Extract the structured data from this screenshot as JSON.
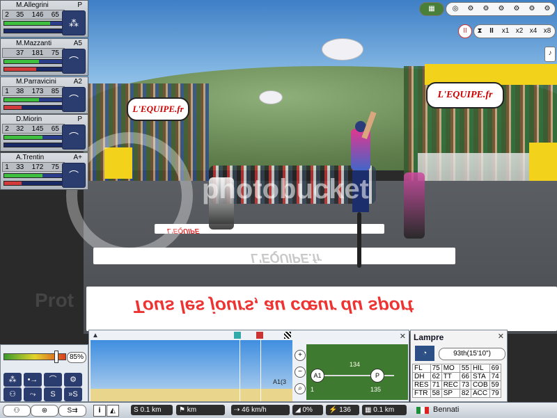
{
  "riders": [
    {
      "pos": "2",
      "name": "M.Allegrini",
      "role": "P",
      "stats": [
        "35",
        "146",
        "65"
      ],
      "bar1_fill": 0.78,
      "bar2_fill": 0.0
    },
    {
      "pos": "",
      "name": "M.Mazzanti",
      "role": "A5",
      "stats": [
        "37",
        "181",
        "75"
      ],
      "bar1_fill": 0.6,
      "bar2_fill": 0.55
    },
    {
      "pos": "1",
      "name": "M.Parravicini",
      "role": "A2",
      "stats": [
        "38",
        "173",
        "85"
      ],
      "bar1_fill": 0.6,
      "bar2_fill": 0.3
    },
    {
      "pos": "2",
      "name": "D.Miorin",
      "role": "P",
      "stats": [
        "32",
        "145",
        "65"
      ],
      "bar1_fill": 0.65,
      "bar2_fill": 0.0
    },
    {
      "pos": "1",
      "name": "A.Trentin",
      "role": "A+",
      "stats": [
        "33",
        "172",
        "75"
      ],
      "bar1_fill": 0.65,
      "bar2_fill": 0.3
    }
  ],
  "scene": {
    "banner_left": "L'EQUIPE.fr",
    "banner_right": "L'EQUIPE.fr",
    "road_text_1": "L'EQUIPE",
    "road_text_2": "L'EQUIPE.fr",
    "road_text_3": "Tous les jours, au cœur du sport",
    "watermark_1": "photobucket",
    "watermark_2": "Prot"
  },
  "speed_controls": {
    "pause": "II",
    "x1": "x1",
    "x2": "x2",
    "x4": "x4",
    "x8": "x8"
  },
  "energy": {
    "percent": "85%",
    "fill": 0.85
  },
  "profile": {
    "label_a1": "A1",
    "label_p": "P",
    "marker_a1": "A1",
    "marker_start": "1",
    "marker_end": "135",
    "marker_mid": "134",
    "sub_label": "A1(3"
  },
  "team": {
    "name": "Lampre",
    "result": "93th(15'10\")",
    "stats": [
      [
        [
          "FL",
          "75"
        ],
        [
          "MO",
          "55"
        ],
        [
          "HIL",
          "69"
        ]
      ],
      [
        [
          "DH",
          "62"
        ],
        [
          "TT",
          "66"
        ],
        [
          "STA",
          "74"
        ]
      ],
      [
        [
          "RES",
          "71"
        ],
        [
          "REC",
          "73"
        ],
        [
          "COB",
          "59"
        ]
      ],
      [
        [
          "FTR",
          "58"
        ],
        [
          "SP",
          "82"
        ],
        [
          "ACC",
          "79"
        ]
      ]
    ]
  },
  "statusbar": {
    "dist1": "0.1 km",
    "dist2": "km",
    "speed": "46 km/h",
    "slope": "0%",
    "power": "136",
    "remaining": "0.1 km",
    "rider_name": "Bennati"
  },
  "colors": {
    "bar_green": "#3fbf3f",
    "bar_red": "#d23b3b",
    "panel_blue": "#2b3c6e"
  }
}
